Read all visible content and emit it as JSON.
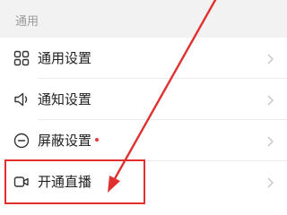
{
  "section": {
    "title": "通用"
  },
  "items": [
    {
      "label": "通用设置",
      "icon": "grid-icon"
    },
    {
      "label": "通知设置",
      "icon": "speaker-icon"
    },
    {
      "label": "屏蔽设置",
      "icon": "minus-circle-icon",
      "badge": "red-dot"
    },
    {
      "label": "开通直播",
      "icon": "video-camera-icon"
    }
  ],
  "colors": {
    "background": "#f2f2f2",
    "list_background": "#ffffff",
    "annotation_red": "#e03030",
    "badge_red": "#e23b3b"
  },
  "annotation": {
    "highlighted_item": "开通直播"
  }
}
